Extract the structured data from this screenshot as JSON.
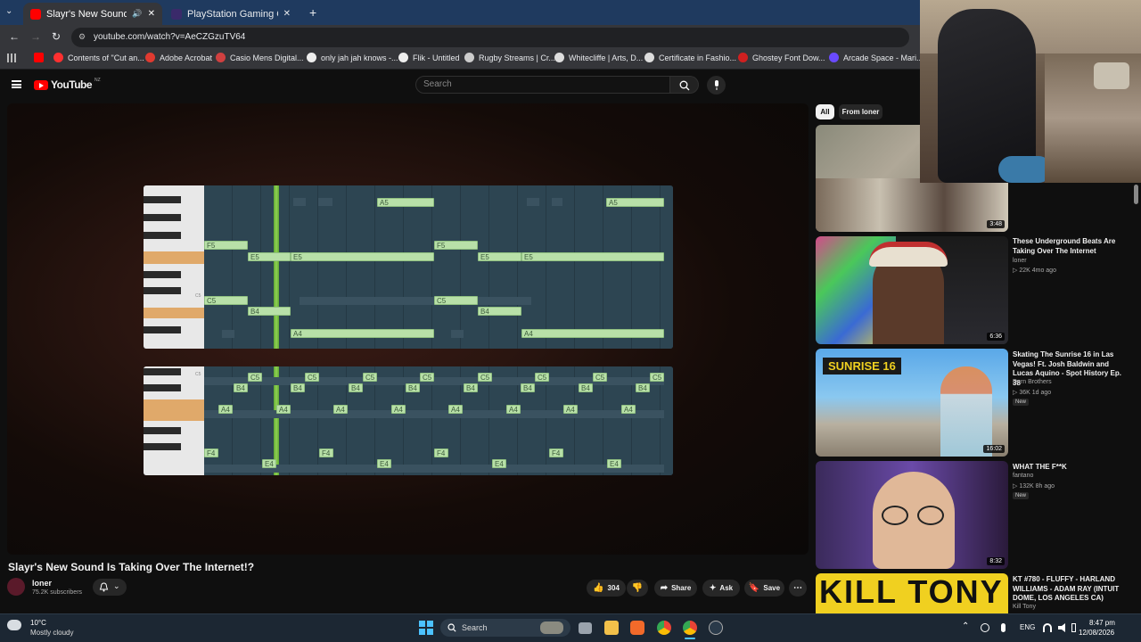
{
  "browser": {
    "tabs": [
      {
        "title": "Slayr's New Sound Is Taking",
        "active": true,
        "favicon_color": "#ff0000"
      },
      {
        "title": "PlayStation Gaming Consoles |",
        "active": false,
        "favicon_color": "#1a1a40"
      }
    ],
    "url": "youtube.com/watch?v=AeCZGzuTV64",
    "bookmarks": [
      {
        "label": "Contents of \"Cut an...",
        "color": "#ff3030"
      },
      {
        "label": "Adobe Acrobat",
        "color": "#e03a30"
      },
      {
        "label": "Casio Mens Digital...",
        "color": "#d04040"
      },
      {
        "label": "only jah jah knows -...",
        "color": "#eeeeee"
      },
      {
        "label": "Flik - Untitled",
        "color": "#eeeeee"
      },
      {
        "label": "Rugby Streams | Cr...",
        "color": "#cccccc"
      },
      {
        "label": "Whitecliffe | Arts, D...",
        "color": "#dddddd"
      },
      {
        "label": "Certificate in Fashio...",
        "color": "#dddddd"
      },
      {
        "label": "Ghostey Font Dow...",
        "color": "#d02020"
      },
      {
        "label": "Arcade Space - Mari...",
        "color": "#6a4aff"
      }
    ]
  },
  "youtube": {
    "logo_text": "YouTube",
    "region": "NZ",
    "search_placeholder": "Search"
  },
  "video": {
    "title": "Slayr's New Sound Is Taking Over The Internet!?",
    "channel": "loner",
    "subscribers": "75.2K subscribers",
    "likes": "304",
    "share_label": "Share",
    "ask_label": "Ask",
    "save_label": "Save"
  },
  "pianoroll_top": {
    "notes": [
      "A5",
      "A5",
      "F5",
      "F5",
      "E5",
      "E5",
      "E5",
      "E5",
      "C5",
      "C5",
      "B4",
      "B4",
      "A4",
      "A4"
    ],
    "key_label": "C5"
  },
  "pianoroll_bottom": {
    "notes": [
      "C5",
      "C5",
      "C5",
      "C5",
      "C5",
      "C5",
      "C5",
      "C5",
      "B4",
      "B4",
      "B4",
      "B4",
      "B4",
      "B4",
      "B4",
      "B4",
      "A4",
      "A4",
      "A4",
      "A4",
      "A4",
      "A4",
      "A4",
      "A4",
      "F4",
      "F4",
      "F4",
      "F4",
      "E4",
      "E4",
      "E4",
      "E4"
    ],
    "key_label": "C5"
  },
  "sidebar": {
    "chips": [
      {
        "label": "All",
        "selected": true
      },
      {
        "label": "From loner",
        "selected": false
      }
    ],
    "videos": [
      {
        "title": "",
        "channel": "",
        "stats": "",
        "duration": "3:48",
        "new": false
      },
      {
        "title": "These Underground Beats Are Taking Over The Internet",
        "channel": "loner",
        "stats": "▷ 22K  4mo ago",
        "duration": "6:36",
        "new": false
      },
      {
        "title": "Skating The Sunrise 16 in Las Vegas! Ft. Josh Baldwin and Lucas Aquino - Spot History Ep. 38",
        "channel": "Dern Brothers",
        "stats": "▷ 36K  1d ago",
        "duration": "16:02",
        "new": true
      },
      {
        "title": "WHAT THE F**K",
        "channel": "fantano",
        "stats": "▷ 132K  8h ago",
        "duration": "8:32",
        "new": true
      },
      {
        "title": "KT #780 - FLUFFY - HARLAND WILLIAMS - ADAM RAY (INTUIT DOME, LOS ANGELES CA)",
        "channel": "Kill Tony",
        "stats": "",
        "duration": "",
        "new": false
      }
    ],
    "thumb_text_sunrise": "SUNRISE 16",
    "thumb_text_kill": "KILL TONY",
    "new_label": "New"
  },
  "taskbar": {
    "weather_temp": "10°C",
    "weather_desc": "Mostly cloudy",
    "search_label": "Search",
    "language": "ENG",
    "time": "8:47 pm",
    "date": "12/08/2026"
  }
}
